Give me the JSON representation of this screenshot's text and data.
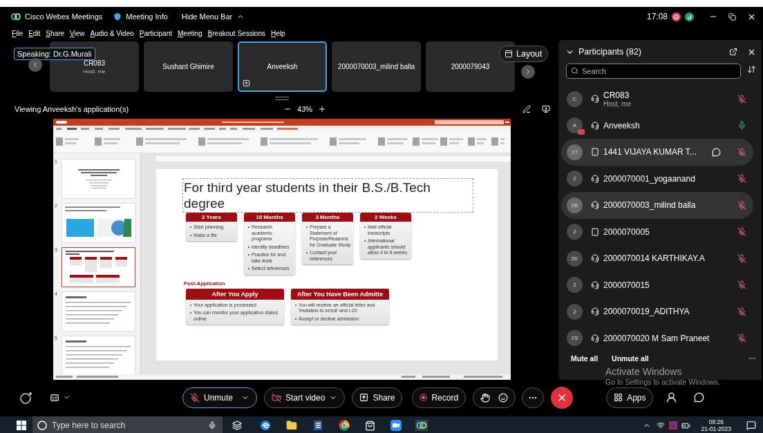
{
  "title_bar": {
    "app": "Cisco Webex Meetings",
    "meeting_info": "Meeting Info",
    "hide_menu": "Hide Menu Bar",
    "time": "17:08"
  },
  "menu": [
    "File",
    "Edit",
    "Share",
    "View",
    "Audio & Video",
    "Participant",
    "Meeting",
    "Breakout Sessions",
    "Help"
  ],
  "speaking": {
    "label": "Speaking:",
    "name": "Dr.G.Murali"
  },
  "video_tiles": [
    {
      "name": "CR083",
      "subtitle": "Host, me",
      "selected": false,
      "sharing": false
    },
    {
      "name": "Sushant Ghimire",
      "selected": false,
      "sharing": false
    },
    {
      "name": "Anveeksh",
      "selected": true,
      "sharing": true
    },
    {
      "name": "2000070003_milind balla",
      "selected": false,
      "sharing": false
    },
    {
      "name": "2000079043",
      "selected": false,
      "sharing": false
    }
  ],
  "layout_button": "Layout",
  "viewing": {
    "label": "Viewing Anveeksh's application(s)",
    "zoom": "43%"
  },
  "presentation": {
    "thumbnails": [
      {
        "number": "1",
        "kind": "title",
        "selected": false
      },
      {
        "number": "2",
        "kind": "picture",
        "selected": false
      },
      {
        "number": "3",
        "kind": "diagram",
        "selected": true
      },
      {
        "number": "4",
        "kind": "bullets",
        "selected": false
      },
      {
        "number": "5",
        "kind": "bullets",
        "selected": false
      }
    ],
    "slide": {
      "title": "For third year students in their B.S./B.Tech degree",
      "timeline": [
        {
          "heading": "2 Years",
          "bullets": [
            {
              "text": "Start planning",
              "italic": false
            },
            {
              "text": "Make a file",
              "italic": false
            }
          ]
        },
        {
          "heading": "18 Months",
          "bullets": [
            {
              "text": "Research academic programs",
              "italic": false
            },
            {
              "text": "Identify deadlines",
              "italic": false
            },
            {
              "text": "Practice for and take tests",
              "italic": false
            },
            {
              "text": "Select references",
              "italic": false
            }
          ]
        },
        {
          "heading": "3 Months",
          "bullets": [
            {
              "text": "Prepare a Statement of Purpose/Reasons for Graduate Study",
              "italic": false
            },
            {
              "text": "Contact your references",
              "italic": false
            }
          ]
        },
        {
          "heading": "2 Weeks",
          "bullets": [
            {
              "text": "Mail official transcripts",
              "italic": false
            },
            {
              "text": "International applicants should allow 4 to 6 weeks",
              "italic": true
            }
          ]
        }
      ],
      "post_heading": "Post-Application",
      "post_cards": [
        {
          "heading": "After You Apply",
          "bullets": [
            {
              "text": "Your application is processed",
              "italic": false
            },
            {
              "text": "You can monitor your application status online",
              "italic": false
            }
          ]
        },
        {
          "heading": "After You Have Been Admitte",
          "bullets": [
            {
              "text": "You will receive an official letter and 'invitation to enroll' and I-20",
              "italic": false
            },
            {
              "text": "Accept or decline admission",
              "italic": false
            }
          ]
        }
      ]
    }
  },
  "participants": {
    "title": "Participants (82)",
    "search_placeholder": "Search",
    "items": [
      {
        "initials": "C",
        "name": "CR083",
        "subtitle": "Host, me",
        "kind": "headset",
        "muted": true,
        "selected": false,
        "chat": false,
        "sharing": false
      },
      {
        "initials": "A",
        "name": "Anveeksh",
        "kind": "headset",
        "muted": false,
        "selected": false,
        "chat": false,
        "sharing": true
      },
      {
        "initials": "1T",
        "name": "1441 VIJAYA KUMAR T...",
        "kind": "phone",
        "muted": true,
        "selected": true,
        "chat": true,
        "sharing": false
      },
      {
        "initials": "2",
        "name": "2000070001_yogaanand",
        "kind": "headset",
        "muted": true,
        "selected": false,
        "chat": false,
        "sharing": false
      },
      {
        "initials": "2B",
        "name": "2000070003_milind balla",
        "kind": "headset",
        "muted": true,
        "selected": true,
        "chat": false,
        "sharing": false
      },
      {
        "initials": "2",
        "name": "2000070005",
        "kind": "phone",
        "muted": true,
        "selected": false,
        "chat": false,
        "sharing": false
      },
      {
        "initials": "2K",
        "name": "2000070014 KARTHIKAY.A",
        "kind": "headset",
        "muted": true,
        "selected": false,
        "chat": false,
        "sharing": false
      },
      {
        "initials": "2",
        "name": "2000070015",
        "kind": "headset",
        "muted": true,
        "selected": false,
        "chat": false,
        "sharing": false
      },
      {
        "initials": "2",
        "name": "2000070019_ADITHYA",
        "kind": "headset",
        "muted": true,
        "selected": false,
        "chat": false,
        "sharing": false
      },
      {
        "initials": "2S",
        "name": "2000070020 M Sam Praneet",
        "kind": "headset",
        "muted": true,
        "selected": false,
        "chat": false,
        "sharing": false
      }
    ],
    "mute_all": "Mute all",
    "unmute_all": "Unmute all"
  },
  "toolbar": {
    "unmute": "Unmute",
    "muted": true,
    "start_video": "Start video",
    "share": "Share",
    "record": "Record",
    "apps": "Apps"
  },
  "activation": {
    "title": "Activate Windows",
    "subtitle": "Go to Settings to activate Windows."
  },
  "taskbar": {
    "search_placeholder": "Type here to search",
    "time": "09:26",
    "date": "21-01-2023"
  }
}
